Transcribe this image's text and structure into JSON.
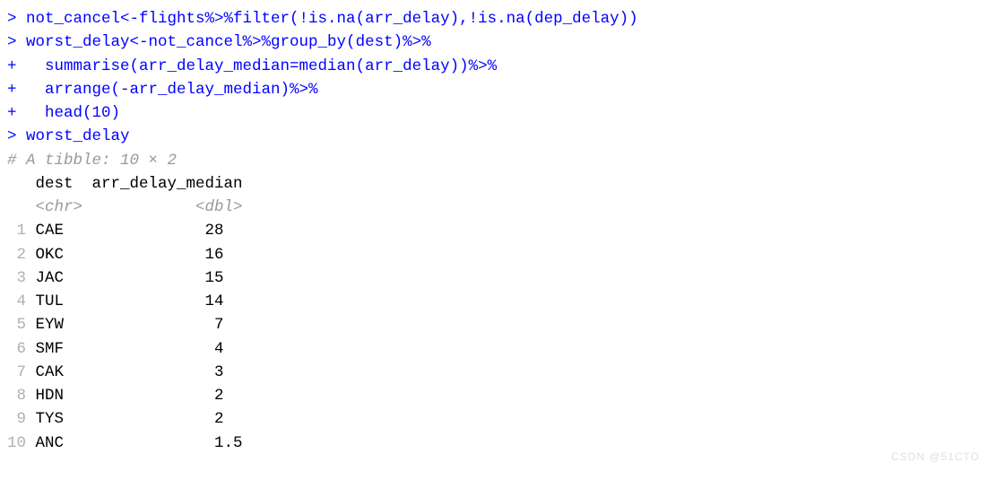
{
  "code": {
    "line1": "> not_cancel<-flights%>%filter(!is.na(arr_delay),!is.na(dep_delay))",
    "line2": "> worst_delay<-not_cancel%>%group_by(dest)%>%",
    "line3": "+   summarise(arr_delay_median=median(arr_delay))%>%",
    "line4": "+   arrange(-arr_delay_median)%>%",
    "line5": "+   head(10)",
    "line6": "> worst_delay"
  },
  "output": {
    "tibble_header": "# A tibble: 10 × 2",
    "col_header": "   dest  arr_delay_median",
    "type_row": "   <chr>            <dbl>",
    "rows": [
      {
        "n": " 1",
        "text": " CAE               28  "
      },
      {
        "n": " 2",
        "text": " OKC               16  "
      },
      {
        "n": " 3",
        "text": " JAC               15  "
      },
      {
        "n": " 4",
        "text": " TUL               14  "
      },
      {
        "n": " 5",
        "text": " EYW                7  "
      },
      {
        "n": " 6",
        "text": " SMF                4  "
      },
      {
        "n": " 7",
        "text": " CAK                3  "
      },
      {
        "n": " 8",
        "text": " HDN                2  "
      },
      {
        "n": " 9",
        "text": " TYS                2  "
      },
      {
        "n": "10",
        "text": " ANC                1.5"
      }
    ]
  },
  "chart_data": {
    "type": "table",
    "title": "A tibble: 10 × 2",
    "columns": [
      "dest",
      "arr_delay_median"
    ],
    "column_types": [
      "<chr>",
      "<dbl>"
    ],
    "rows": [
      {
        "dest": "CAE",
        "arr_delay_median": 28
      },
      {
        "dest": "OKC",
        "arr_delay_median": 16
      },
      {
        "dest": "JAC",
        "arr_delay_median": 15
      },
      {
        "dest": "TUL",
        "arr_delay_median": 14
      },
      {
        "dest": "EYW",
        "arr_delay_median": 7
      },
      {
        "dest": "SMF",
        "arr_delay_median": 4
      },
      {
        "dest": "CAK",
        "arr_delay_median": 3
      },
      {
        "dest": "HDN",
        "arr_delay_median": 2
      },
      {
        "dest": "TYS",
        "arr_delay_median": 2
      },
      {
        "dest": "ANC",
        "arr_delay_median": 1.5
      }
    ]
  },
  "watermark": "CSDN @51CTO"
}
